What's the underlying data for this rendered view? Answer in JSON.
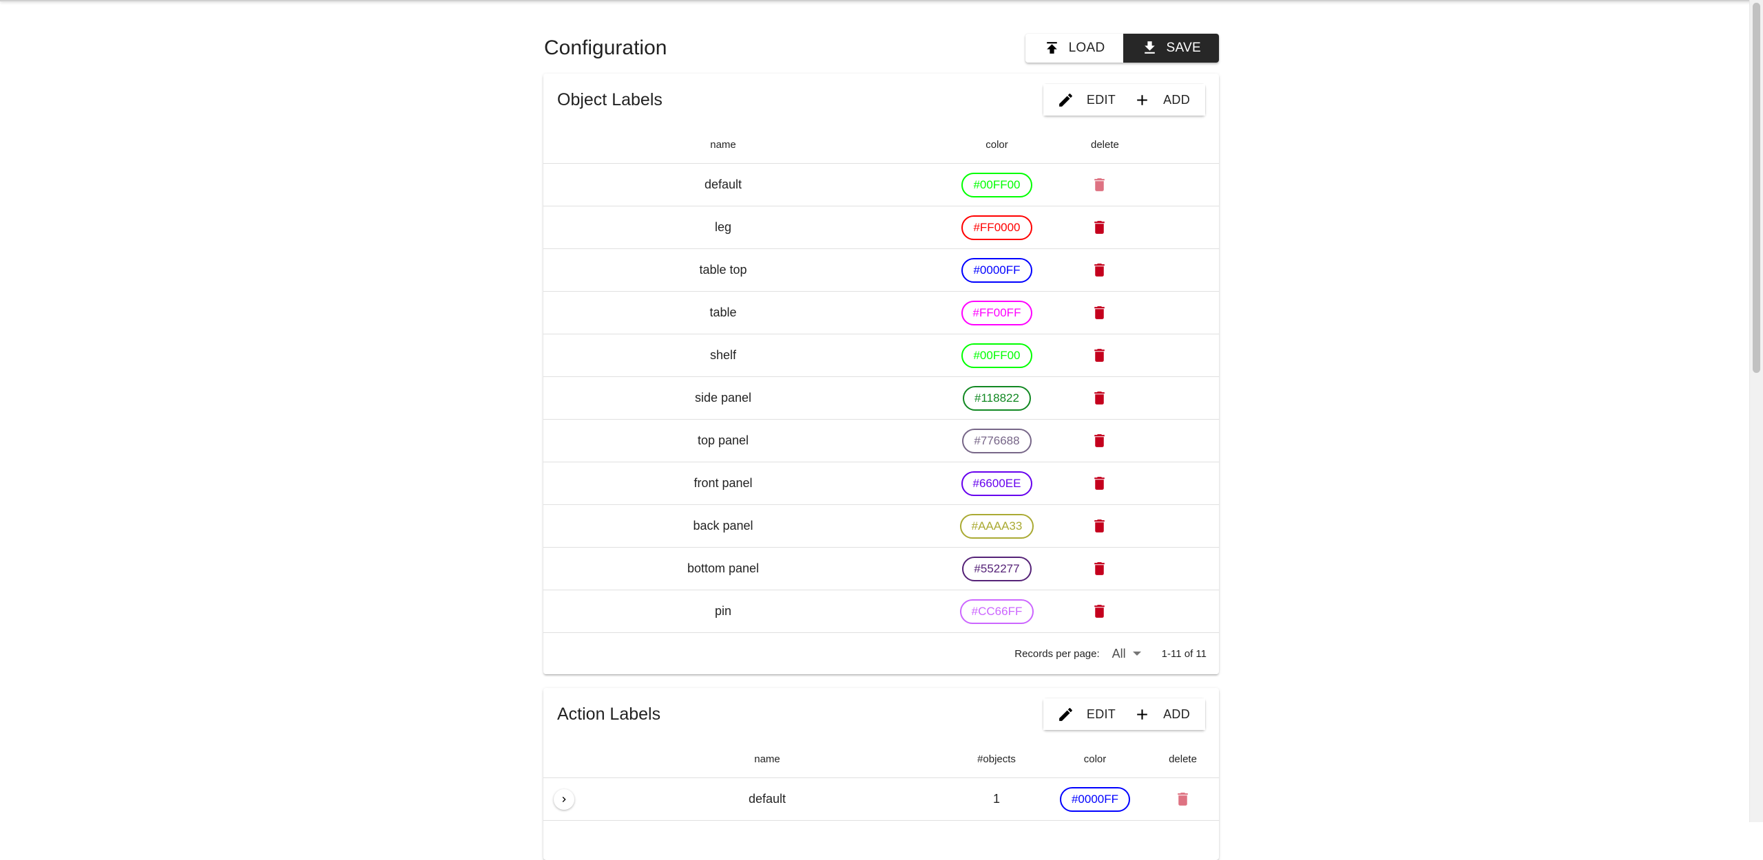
{
  "page": {
    "title": "Configuration",
    "load_label": "LOAD",
    "save_label": "SAVE"
  },
  "object_labels": {
    "title": "Object Labels",
    "edit_label": "EDIT",
    "add_label": "ADD",
    "columns": [
      "name",
      "color",
      "delete"
    ],
    "rows": [
      {
        "name": "default",
        "color": "#00FF00"
      },
      {
        "name": "leg",
        "color": "#FF0000"
      },
      {
        "name": "table top",
        "color": "#0000FF"
      },
      {
        "name": "table",
        "color": "#FF00FF"
      },
      {
        "name": "shelf",
        "color": "#00FF00"
      },
      {
        "name": "side panel",
        "color": "#118822"
      },
      {
        "name": "top panel",
        "color": "#776688"
      },
      {
        "name": "front panel",
        "color": "#6600EE"
      },
      {
        "name": "back panel",
        "color": "#AAAA33"
      },
      {
        "name": "bottom panel",
        "color": "#552277"
      },
      {
        "name": "pin",
        "color": "#CC66FF"
      }
    ],
    "footer": {
      "records_per_page_label": "Records per page:",
      "records_per_page_value": "All",
      "range": "1-11 of 11"
    }
  },
  "action_labels": {
    "title": "Action Labels",
    "edit_label": "EDIT",
    "add_label": "ADD",
    "columns": [
      "name",
      "#objects",
      "color",
      "delete"
    ],
    "rows": [
      {
        "name": "default",
        "objects": "1",
        "color": "#0000FF"
      }
    ]
  },
  "colors": {
    "delete_icon": "#c4001d",
    "save_button_bg": "#272727"
  }
}
